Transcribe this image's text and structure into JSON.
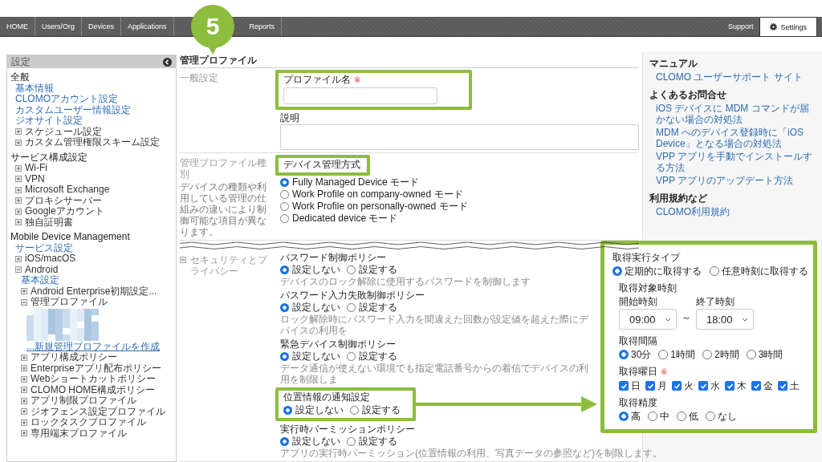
{
  "nav": {
    "tabs": [
      {
        "label": "HOME",
        "selected": false
      },
      {
        "label": "Users/Org",
        "selected": false
      },
      {
        "label": "Devices",
        "selected": false
      },
      {
        "label": "Applications",
        "selected": false
      },
      {
        "label": "Reports",
        "selected": false
      }
    ],
    "right_tabs": [
      {
        "label": "Support",
        "selected": false
      },
      {
        "label": "Settings",
        "selected": true
      }
    ]
  },
  "step_badge": "5",
  "sidebar": {
    "title": "設定",
    "groups": [
      {
        "heading": "全般",
        "items": [
          {
            "kind": "link",
            "label": "基本情報"
          },
          {
            "kind": "link",
            "label": "CLOMOアカウント設定"
          },
          {
            "kind": "link",
            "label": "カスタムユーザー情報設定"
          },
          {
            "kind": "link",
            "label": "ジオサイト設定"
          },
          {
            "kind": "node",
            "label": "スケジュール設定",
            "expanded": false
          },
          {
            "kind": "node",
            "label": "カスタム管理権限スキーム設定",
            "expanded": false
          }
        ]
      },
      {
        "heading": "サービス構成設定",
        "items": [
          {
            "kind": "node",
            "label": "Wi-Fi",
            "expanded": false
          },
          {
            "kind": "node",
            "label": "VPN",
            "expanded": false
          },
          {
            "kind": "node",
            "label": "Microsoft Exchange",
            "expanded": false
          },
          {
            "kind": "node",
            "label": "プロキシサーバー",
            "expanded": false
          },
          {
            "kind": "node",
            "label": "Googleアカウント",
            "expanded": false
          },
          {
            "kind": "node",
            "label": "独自証明書",
            "expanded": false
          }
        ]
      },
      {
        "heading": "Mobile Device Management",
        "items": [
          {
            "kind": "link",
            "label": "サービス設定"
          },
          {
            "kind": "node",
            "label": "iOS/macOS",
            "expanded": false
          },
          {
            "kind": "node",
            "label": "Android",
            "expanded": true,
            "children": [
              {
                "kind": "link",
                "label": "基本設定"
              },
              {
                "kind": "node",
                "label": "Android Enterprise初期設定...",
                "expanded": false
              },
              {
                "kind": "node",
                "label": "管理プロファイル",
                "expanded": true,
                "children": [
                  {
                    "kind": "redacted"
                  },
                  {
                    "kind": "action_link",
                    "label": "...新規管理プロファイルを作成"
                  }
                ]
              },
              {
                "kind": "node",
                "label": "アプリ構成ポリシー",
                "expanded": false
              },
              {
                "kind": "node",
                "label": "Enterpriseアプリ配布ポリシー",
                "expanded": false
              },
              {
                "kind": "node",
                "label": "Webショートカットポリシー",
                "expanded": false
              },
              {
                "kind": "node",
                "label": "CLOMO HOME構成ポリシー",
                "expanded": false
              },
              {
                "kind": "node",
                "label": "アプリ制限プロファイル",
                "expanded": false
              },
              {
                "kind": "node",
                "label": "ジオフェンス設定プロファイル",
                "expanded": false
              },
              {
                "kind": "node",
                "label": "ロックタスクプロファイル",
                "expanded": false
              },
              {
                "kind": "node",
                "label": "専用端末プロファイル",
                "expanded": false
              }
            ]
          }
        ]
      }
    ]
  },
  "page": {
    "title": "管理プロファイル",
    "sections": [
      {
        "kind": "fields",
        "label": "一般設定",
        "fields": [
          {
            "kind": "text",
            "label": "プロファイル名",
            "required_mark": "※",
            "label_framed": true,
            "control_framed": true
          },
          {
            "kind": "textarea",
            "label": "説明",
            "label_framed": false,
            "control_framed": false
          }
        ]
      },
      {
        "kind": "fields",
        "label": "管理プロファイル種別",
        "description": "デバイスの種類や利用している管理の仕組みの違いにより制御可能な項目が異なります。",
        "fields": [
          {
            "kind": "radios",
            "label": "デバイス管理方式",
            "label_framed": true,
            "control_framed": false,
            "options": [
              {
                "label": "Fully Managed Device モード",
                "selected": true
              },
              {
                "label": "Work Profile on company-owned モード",
                "selected": false
              },
              {
                "label": "Work Profile on personally-owned モード",
                "selected": false
              },
              {
                "label": "Dedicated device モード",
                "selected": false
              }
            ]
          }
        ]
      },
      {
        "kind": "break"
      },
      {
        "kind": "fields",
        "label": "セキュリティとプライバシー",
        "expanded": true,
        "fields": [
          {
            "kind": "radios",
            "label": "パスワード制御ポリシー",
            "label_framed": false,
            "control_framed": false,
            "options": [
              {
                "label": "設定しない",
                "selected": true
              },
              {
                "label": "設定する",
                "selected": false
              }
            ],
            "note": "デバイスのロック解除に使用するパスワードを制御します"
          },
          {
            "kind": "radios",
            "label": "パスワード入力失敗制御ポリシー",
            "label_framed": false,
            "control_framed": false,
            "options": [
              {
                "label": "設定しない",
                "selected": true
              },
              {
                "label": "設定する",
                "selected": false
              }
            ],
            "note": "ロック解除時にパスワード入力を間違えた回数が設定値を超えた際にデバイスの利用を"
          },
          {
            "kind": "radios",
            "label": "緊急デバイス制御ポリシー",
            "label_framed": false,
            "control_framed": false,
            "options": [
              {
                "label": "設定しない",
                "selected": true
              },
              {
                "label": "設定する",
                "selected": false
              }
            ],
            "note": "データ通信が使えない環境でも指定電話番号からの着信でデバイスの利用を制限しま"
          },
          {
            "kind": "radios",
            "label": "位置情報の通知設定",
            "label_framed": true,
            "control_framed": true,
            "options": [
              {
                "label": "設定しない",
                "selected": true
              },
              {
                "label": "設定する",
                "selected": false
              }
            ]
          },
          {
            "kind": "radios",
            "label": "実行時パーミッションポリシー",
            "label_framed": false,
            "control_framed": false,
            "options": [
              {
                "label": "設定しない",
                "selected": true
              },
              {
                "label": "設定する",
                "selected": false
              }
            ],
            "note": "アプリの実行時パーミッション(位置情報の利用、写真データの参照など)を制限します。"
          }
        ]
      }
    ]
  },
  "help": {
    "groups": [
      {
        "heading": "マニュアル",
        "links": [
          "CLOMO ユーザーサポート サイト"
        ]
      },
      {
        "heading": "よくあるお問合せ",
        "links": [
          "iOS デバイスに MDM コマンドが届かない場合の対処法",
          "MDM へのデバイス登録時に「iOS Device」となる場合の対処法",
          "VPP アプリを手動でインストールする方法",
          "VPP アプリのアップデート方法"
        ]
      },
      {
        "heading": "利用規約など",
        "links": [
          "CLOMO利用規約"
        ]
      }
    ]
  },
  "popup": {
    "execution_type": {
      "label": "取得実行タイプ",
      "options": [
        {
          "label": "定期的に取得する",
          "selected": true
        },
        {
          "label": "任意時刻に取得する",
          "selected": false
        }
      ]
    },
    "settings": [
      {
        "kind": "time_range",
        "label": "取得対象時刻",
        "start": {
          "label": "開始時刻",
          "value": "09:00"
        },
        "separator": "～",
        "end": {
          "label": "終了時刻",
          "value": "18:00"
        }
      },
      {
        "kind": "radios",
        "label": "取得間隔",
        "options": [
          {
            "label": "30分",
            "selected": true
          },
          {
            "label": "1時間",
            "selected": false
          },
          {
            "label": "2時間",
            "selected": false
          },
          {
            "label": "3時間",
            "selected": false
          }
        ]
      },
      {
        "kind": "checkboxes",
        "label": "取得曜日",
        "required_mark": "※",
        "options": [
          {
            "label": "日",
            "checked": true
          },
          {
            "label": "月",
            "checked": true
          },
          {
            "label": "火",
            "checked": true
          },
          {
            "label": "水",
            "checked": true
          },
          {
            "label": "木",
            "checked": true
          },
          {
            "label": "金",
            "checked": true
          },
          {
            "label": "土",
            "checked": true
          }
        ]
      },
      {
        "kind": "radios",
        "label": "取得精度",
        "options": [
          {
            "label": "高",
            "selected": true
          },
          {
            "label": "中",
            "selected": false
          },
          {
            "label": "低",
            "selected": false
          },
          {
            "label": "なし",
            "selected": false
          }
        ]
      }
    ]
  }
}
